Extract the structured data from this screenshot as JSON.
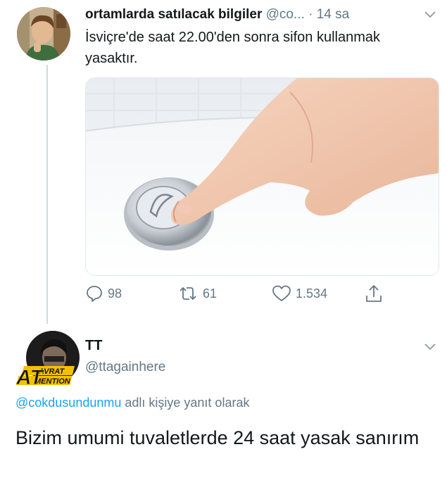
{
  "tweet1": {
    "author_name": "ortamlarda satılacak bilgiler",
    "handle": "@co...",
    "time": "· 14 sa",
    "text": "İsviçre'de saat 22.00'den sonra sifon kullanmak yasaktır.",
    "media_alt": "finger pressing toilet flush button",
    "actions": {
      "reply_count": "98",
      "retweet_count": "61",
      "like_count": "1.534"
    }
  },
  "tweet2": {
    "author_name": "TT",
    "handle": "@ttagainhere",
    "avatar_badge_top": "AVRAT",
    "avatar_badge_left": "AT",
    "avatar_badge_bottom": "MENTION",
    "reply_to_mention": "@cokdusundunmu",
    "reply_to_suffix": " adlı kişiye yanıt olarak",
    "text": "Bizim umumi tuvaletlerde 24 saat yasak sanırım"
  },
  "colors": {
    "link": "#1da1f2",
    "secondary_text": "#657786",
    "primary_text": "#14171a",
    "thread_line": "#cfd9de"
  },
  "icons": [
    "chevron-down-icon",
    "reply-icon",
    "retweet-icon",
    "like-icon",
    "share-icon"
  ]
}
